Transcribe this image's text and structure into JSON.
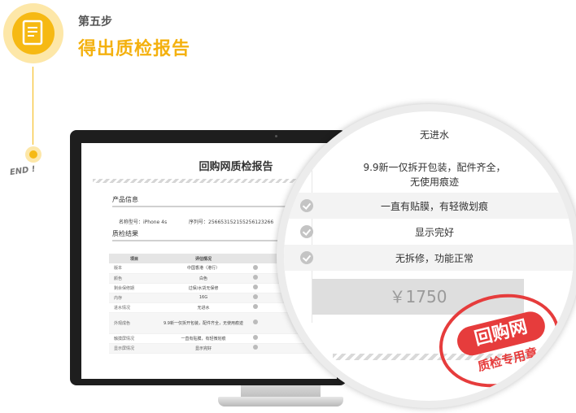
{
  "step": {
    "label": "第五步",
    "title": "得出质检报告",
    "end_text": "END !"
  },
  "report": {
    "title": "回购网质检报告",
    "product_info_heading": "产品信息",
    "model_label": "名称型号：iPhone 4s",
    "serial_label": "序列号：256653152155256123266",
    "qc_result_heading": "质检结果",
    "table_headers": [
      "项目",
      "评估情况"
    ],
    "rows": [
      {
        "item": "版本",
        "status": "中国香港（港行）"
      },
      {
        "item": "颜色",
        "status": "白色"
      },
      {
        "item": "剩余保修期",
        "status": "过保/水货无保修"
      },
      {
        "item": "内存",
        "status": "16G"
      },
      {
        "item": "进水情况",
        "status": "无进水"
      },
      {
        "item": "外观成色",
        "status": "9.9新一仅拆开包装，配件齐全，无使用痕迹"
      },
      {
        "item": "触摸屏情况",
        "status": "一直有贴膜，有轻微划痕"
      },
      {
        "item": "显示屏情况",
        "status": "显示完好"
      }
    ]
  },
  "magnifier": {
    "water": "无进水",
    "appearance_line1": "9.9新一仅拆开包装，配件齐全，",
    "appearance_line2": "无使用痕迹",
    "touch": "一直有贴膜，有轻微划痕",
    "display": "显示完好",
    "function": "无拆修，功能正常",
    "price": "￥1750"
  },
  "stamp": {
    "main": "回购网",
    "sub": "质检专用章"
  },
  "colors": {
    "accent": "#f4b10f",
    "stamp": "#e63c3c"
  }
}
